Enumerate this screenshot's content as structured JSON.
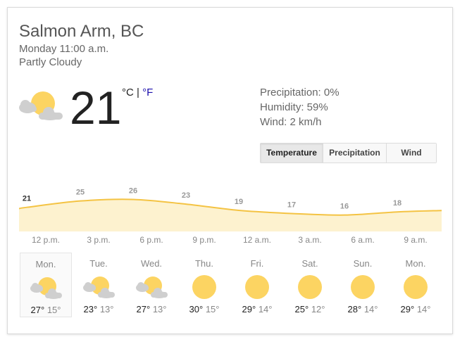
{
  "location": "Salmon Arm, BC",
  "datetime": "Monday 11:00 a.m.",
  "condition": "Partly Cloudy",
  "current": {
    "temperature": "21",
    "unit_c": "°C",
    "unit_sep": " | ",
    "unit_f": "°F",
    "icon": "partly-cloudy-icon"
  },
  "details": {
    "precipitation": "Precipitation: 0%",
    "humidity": "Humidity: 59%",
    "wind": "Wind: 2 km/h"
  },
  "tabs": {
    "temperature": "Temperature",
    "precipitation": "Precipitation",
    "wind": "Wind",
    "active": "temperature"
  },
  "colors": {
    "line": "#f4c343",
    "fill": "#fdf2cf",
    "sun": "#fcd462",
    "cloud": "#cfcfcf"
  },
  "hourly": {
    "labels": [
      "12 p.m.",
      "3 p.m.",
      "6 p.m.",
      "9 p.m.",
      "12 a.m.",
      "3 a.m.",
      "6 a.m.",
      "9 a.m."
    ],
    "temps": [
      "21",
      "25",
      "26",
      "23",
      "19",
      "17",
      "16",
      "18"
    ]
  },
  "chart_data": {
    "type": "area",
    "x": [
      "12 p.m.",
      "3 p.m.",
      "6 p.m.",
      "9 p.m.",
      "12 a.m.",
      "3 a.m.",
      "6 a.m.",
      "9 a.m."
    ],
    "values": [
      21,
      25,
      26,
      23,
      19,
      17,
      16,
      18
    ],
    "ylim": [
      10,
      28
    ],
    "grid": false
  },
  "daily": [
    {
      "name": "Mon.",
      "hi": "27°",
      "lo": "15°",
      "icon": "partly-cloudy-icon",
      "selected": true
    },
    {
      "name": "Tue.",
      "hi": "23°",
      "lo": "13°",
      "icon": "partly-cloudy-icon"
    },
    {
      "name": "Wed.",
      "hi": "27°",
      "lo": "13°",
      "icon": "partly-cloudy-icon"
    },
    {
      "name": "Thu.",
      "hi": "30°",
      "lo": "15°",
      "icon": "sunny-icon"
    },
    {
      "name": "Fri.",
      "hi": "29°",
      "lo": "14°",
      "icon": "sunny-icon"
    },
    {
      "name": "Sat.",
      "hi": "25°",
      "lo": "12°",
      "icon": "sunny-icon"
    },
    {
      "name": "Sun.",
      "hi": "28°",
      "lo": "14°",
      "icon": "sunny-icon"
    },
    {
      "name": "Mon.",
      "hi": "29°",
      "lo": "14°",
      "icon": "sunny-icon"
    }
  ]
}
